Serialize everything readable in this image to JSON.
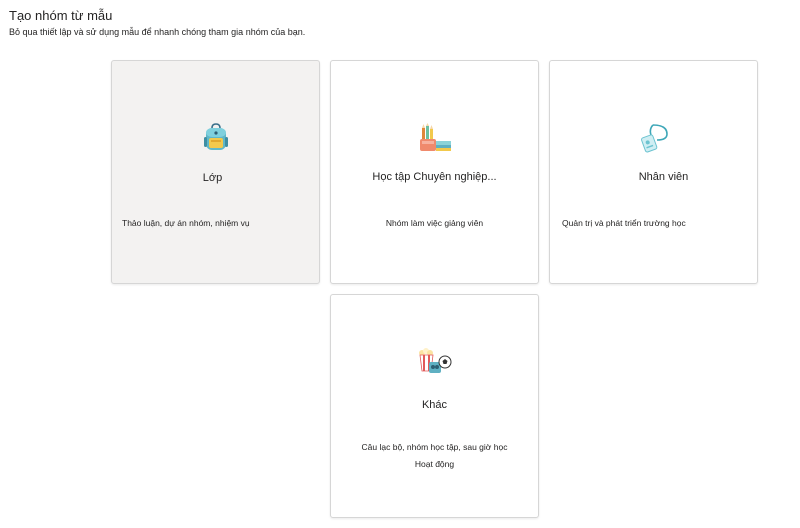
{
  "header": {
    "title": "Tạo nhóm từ mẫu",
    "subtitle": "Bỏ qua thiết lập và sử dụng mẫu để nhanh chóng tham gia nhóm của bạn."
  },
  "templates": [
    {
      "title": "Lớp",
      "description": "Thảo luận, dự án nhóm, nhiệm vụ",
      "icon": "backpack-icon",
      "selected": true
    },
    {
      "title": "Học tập Chuyên nghiệp...",
      "description": "Nhóm làm việc giảng viên",
      "icon": "books-pencils-icon"
    },
    {
      "title": "Nhân viên",
      "description": "Quản trị và phát triển trường học",
      "icon": "lanyard-badge-icon"
    },
    {
      "title": "Khác",
      "description_line1": "Câu lạc bộ, nhóm học tập, sau giờ học",
      "description_line2": "Hoạt động",
      "icon": "popcorn-soccer-icon"
    }
  ],
  "colors": {
    "card_selected_bg": "#f3f2f1",
    "card_border": "#d6d6d6",
    "text": "#252424"
  }
}
